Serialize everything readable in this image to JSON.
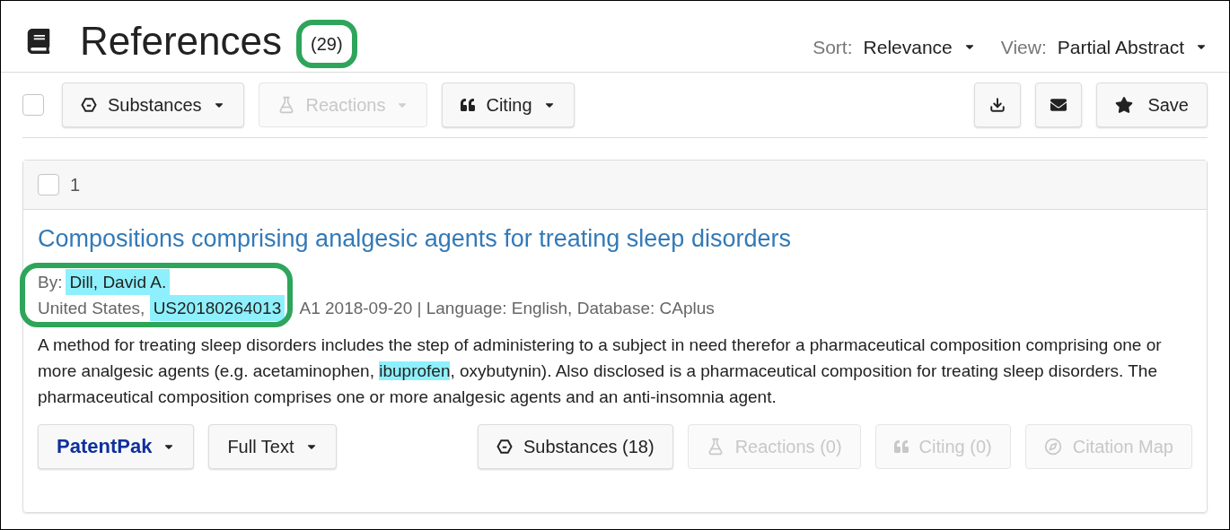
{
  "header": {
    "title": "References",
    "count": "(29)",
    "sort": {
      "label": "Sort:",
      "value": "Relevance"
    },
    "view": {
      "label": "View:",
      "value": "Partial Abstract"
    }
  },
  "toolbar": {
    "select_all": {
      "checked": false
    },
    "buttons": [
      {
        "label": "Substances",
        "disabled": false,
        "dropdown": true
      },
      {
        "label": "Reactions",
        "disabled": true,
        "dropdown": true
      },
      {
        "label": "Citing",
        "disabled": false,
        "dropdown": true
      }
    ],
    "save": {
      "label": "Save"
    }
  },
  "result": {
    "checked": false,
    "number": "1",
    "title": "Compositions comprising analgesic agents for treating sleep disorders",
    "by_label": "By:",
    "author": "Dill, David A.",
    "meta": [
      {
        "text": "United States, ",
        "highlighted": false
      },
      {
        "text": "US20180264013",
        "highlighted": true
      },
      {
        "text": " A1 2018-09-20 | Language: English, Database: CAplus",
        "highlighted": false
      }
    ],
    "abstract": [
      {
        "text": "A method for treating sleep disorders includes the step of administering to a subject in need therefor a pharmaceutical composition comprising one or more analgesic agents (e.g. acetaminophen, ",
        "highlighted": false
      },
      {
        "text": "ibuprofen",
        "highlighted": true
      },
      {
        "text": ", oxybutynin). Also disclosed is a pharmaceutical composition for treating sleep disorders. The pharmaceutical composition comprises one or more analgesic agents and an anti-insomnia agent.",
        "highlighted": false
      }
    ],
    "left_buttons": [
      {
        "label": "PatentPak",
        "kind": "brand",
        "dropdown": true
      },
      {
        "label": "Full Text",
        "kind": "plain",
        "dropdown": true
      }
    ],
    "right_buttons": [
      {
        "label": "Substances (18)",
        "disabled": false
      },
      {
        "label": "Reactions (0)",
        "disabled": true
      },
      {
        "label": "Citing (0)",
        "disabled": true
      },
      {
        "label": "Citation Map",
        "disabled": true
      }
    ]
  }
}
